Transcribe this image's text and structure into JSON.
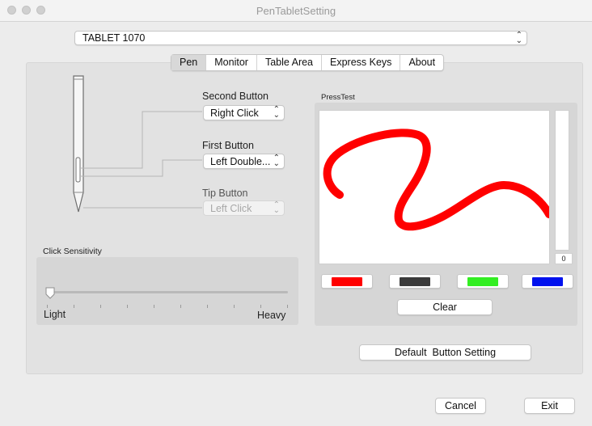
{
  "window": {
    "title": "PenTabletSetting"
  },
  "device": {
    "selected": "TABLET 1070"
  },
  "tabs": [
    {
      "label": "Pen",
      "active": true
    },
    {
      "label": "Monitor"
    },
    {
      "label": "Table Area"
    },
    {
      "label": "Express Keys"
    },
    {
      "label": "About"
    }
  ],
  "pen_buttons": {
    "second": {
      "label": "Second Button",
      "value": "Right Click"
    },
    "first": {
      "label": "First Button",
      "value": "Left Double..."
    },
    "tip": {
      "label": "Tip Button",
      "value": "Left Click",
      "disabled": true
    }
  },
  "click_sensitivity": {
    "label": "Click Sensitivity",
    "min_label": "Light",
    "max_label": "Heavy",
    "level": 0
  },
  "press_test": {
    "label": "PressTest",
    "pressure_value": "0",
    "colors": [
      {
        "name": "red",
        "hex": "#ff0000"
      },
      {
        "name": "dark-gray",
        "hex": "#3b3b3b"
      },
      {
        "name": "green",
        "hex": "#33ee22"
      },
      {
        "name": "blue",
        "hex": "#0011ee"
      }
    ],
    "stroke_color": "#ff0000",
    "clear_label": "Clear"
  },
  "buttons": {
    "default_setting": "Default  Button Setting",
    "cancel": "Cancel",
    "exit": "Exit"
  }
}
